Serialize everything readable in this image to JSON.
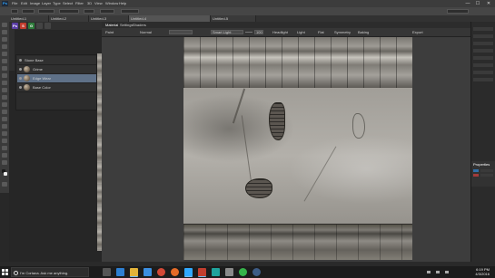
{
  "photoshop": {
    "logo": "Ps",
    "menu": [
      "File",
      "Edit",
      "Image",
      "Layer",
      "Type",
      "Select",
      "Filter",
      "3D",
      "View",
      "Window",
      "Help"
    ],
    "document_tabs": [
      {
        "label": "Untitled-1",
        "active": false
      },
      {
        "label": "Untitled-2",
        "active": false
      },
      {
        "label": "Untitled-3",
        "active": false
      },
      {
        "label": "Untitled-4",
        "active": true
      },
      {
        "label": "Untitled-5",
        "active": false
      }
    ],
    "window_controls": [
      "—",
      "☐",
      "✕"
    ]
  },
  "substance": {
    "app_buttons": [
      "Ps",
      "S",
      "G"
    ],
    "layers": [
      {
        "name": "Stone Base",
        "selected": false,
        "is_folder": true
      },
      {
        "name": "Grime",
        "selected": false
      },
      {
        "name": "Edge Wear",
        "selected": true
      },
      {
        "name": "Base Color",
        "selected": false
      }
    ],
    "view_tabs": [
      "Material",
      "Settings",
      "Shaders"
    ],
    "toolbar": {
      "preset": "Paint",
      "mode": "Normal",
      "smart_label": "Smart Light",
      "value": "100",
      "items": [
        "Headlight",
        "Light",
        "Flat",
        "Symmetry",
        "Baking",
        "Export"
      ]
    }
  },
  "right_panel": {
    "title": "Properties",
    "colors": [
      "#2f6fa8",
      "#a23b3b"
    ]
  },
  "taskbar": {
    "search_placeholder": "I'm Cortana. Ask me anything.",
    "time": "6:19 PM",
    "date": "4/3/2016",
    "apps": [
      {
        "icon": "task-view-icon",
        "color": "#555555",
        "active": false
      },
      {
        "icon": "edge-icon",
        "color": "#2d7fd1",
        "active": false
      },
      {
        "icon": "file-explorer-icon",
        "color": "#e2b33a",
        "active": true
      },
      {
        "icon": "store-icon",
        "color": "#3b8ee0",
        "active": false
      },
      {
        "icon": "chrome-icon",
        "color": "#d34836",
        "active": false
      },
      {
        "icon": "firefox-icon",
        "color": "#e66b27",
        "active": false
      },
      {
        "icon": "photoshop-icon",
        "color": "#31a8ff",
        "active": true
      },
      {
        "icon": "substance-icon",
        "color": "#c23d2e",
        "active": true
      },
      {
        "icon": "maya-icon",
        "color": "#1fa29c",
        "active": false
      },
      {
        "icon": "zbrush-icon",
        "color": "#8a8a8a",
        "active": false
      },
      {
        "icon": "spotify-icon",
        "color": "#36b34a",
        "active": false
      },
      {
        "icon": "steam-icon",
        "color": "#3d5c86",
        "active": false
      }
    ]
  },
  "colors": {
    "accent": "#5f7188",
    "ps_blue": "#31a8ff"
  }
}
